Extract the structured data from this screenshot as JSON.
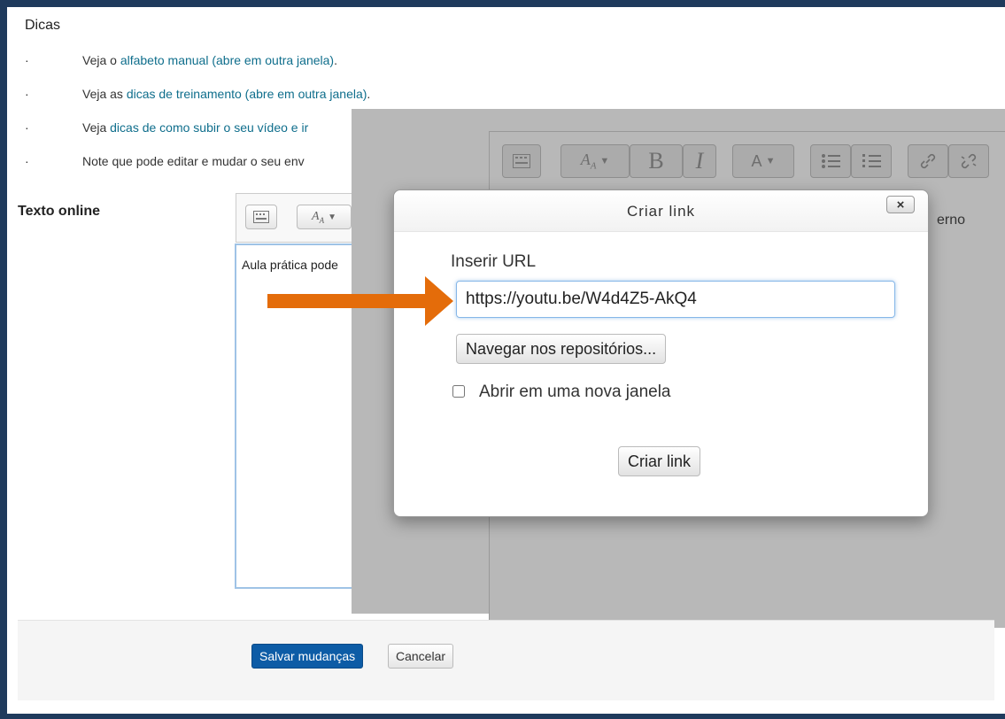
{
  "page": {
    "dicas_title": "Dicas",
    "tips": [
      {
        "prefix": "Veja o ",
        "link": "alfabeto manual (abre em outra janela)",
        "suffix": "."
      },
      {
        "prefix": "Veja as ",
        "link": "dicas de treinamento (abre em outra janela)",
        "suffix": "."
      },
      {
        "prefix": "Veja ",
        "link": "dicas de como subir o seu vídeo e ir",
        "suffix": ""
      },
      {
        "prefix": "Note que pode editar e mudar o seu env",
        "link": "",
        "suffix": ""
      }
    ],
    "bullet": "·",
    "texto_online_label": "Texto online",
    "editor_content": "Aula prática pode",
    "bg_partial_text": "erno"
  },
  "toolbar_icons": [
    "keyboard-icon",
    "font-size-icon",
    "bold-icon",
    "italic-icon",
    "font-color-icon",
    "unordered-list-icon",
    "ordered-list-icon",
    "link-icon",
    "unlink-icon"
  ],
  "toolbar_glyphs": {
    "bold": "B",
    "italic": "I"
  },
  "dialog": {
    "title": "Criar link",
    "close_label": "×",
    "url_label": "Inserir URL",
    "url_value": "https://youtu.be/W4d4Z5-AkQ4",
    "browse_label": "Navegar nos repositórios...",
    "new_window_label": "Abrir em uma nova janela",
    "new_window_checked": false,
    "create_label": "Criar link"
  },
  "actions": {
    "save_label": "Salvar mudanças",
    "cancel_label": "Cancelar"
  },
  "colors": {
    "frame": "#1f3a5c",
    "link": "#0f6e8c",
    "primary": "#0d5ca6",
    "arrow": "#e46c0a",
    "overlay": "#b8b8b8"
  }
}
